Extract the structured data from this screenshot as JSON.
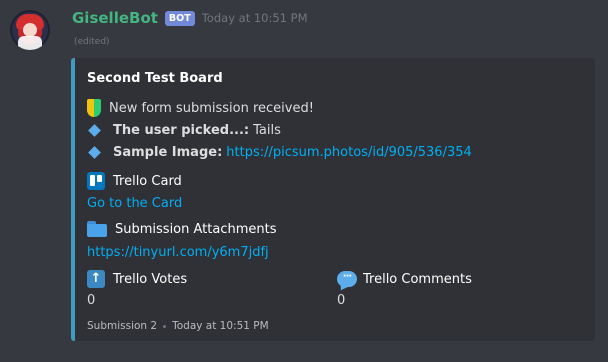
{
  "message": {
    "username": "GiselleBot",
    "bot_tag": "BOT",
    "timestamp": "Today at 10:51 PM",
    "edited": "(edited)"
  },
  "embed": {
    "accent_color": "#3e9cbf",
    "title": "Second Test Board",
    "lines": [
      {
        "icon": "beginner-badge-icon",
        "text": "New form submission received!"
      },
      {
        "icon": "blue-diamond-icon",
        "label": "The user picked...:",
        "value": "Tails"
      },
      {
        "icon": "blue-diamond-icon",
        "label": "Sample Image:",
        "link": "https://picsum.photos/id/905/536/354"
      }
    ],
    "fields": {
      "trello_card": {
        "icon": "trello-icon",
        "name": "Trello Card",
        "value": "Go to the Card"
      },
      "attachments": {
        "icon": "folder-icon",
        "name": "Submission Attachments",
        "value": "https://tinyurl.com/y6m7jdfj"
      },
      "votes": {
        "icon": "up-arrow-icon",
        "name": "Trello Votes",
        "value": "0"
      },
      "comments": {
        "icon": "speech-bubble-icon",
        "name": "Trello Comments",
        "value": "0"
      }
    },
    "footer": {
      "text": "Submission 2",
      "timestamp": "Today at 10:51 PM"
    }
  }
}
